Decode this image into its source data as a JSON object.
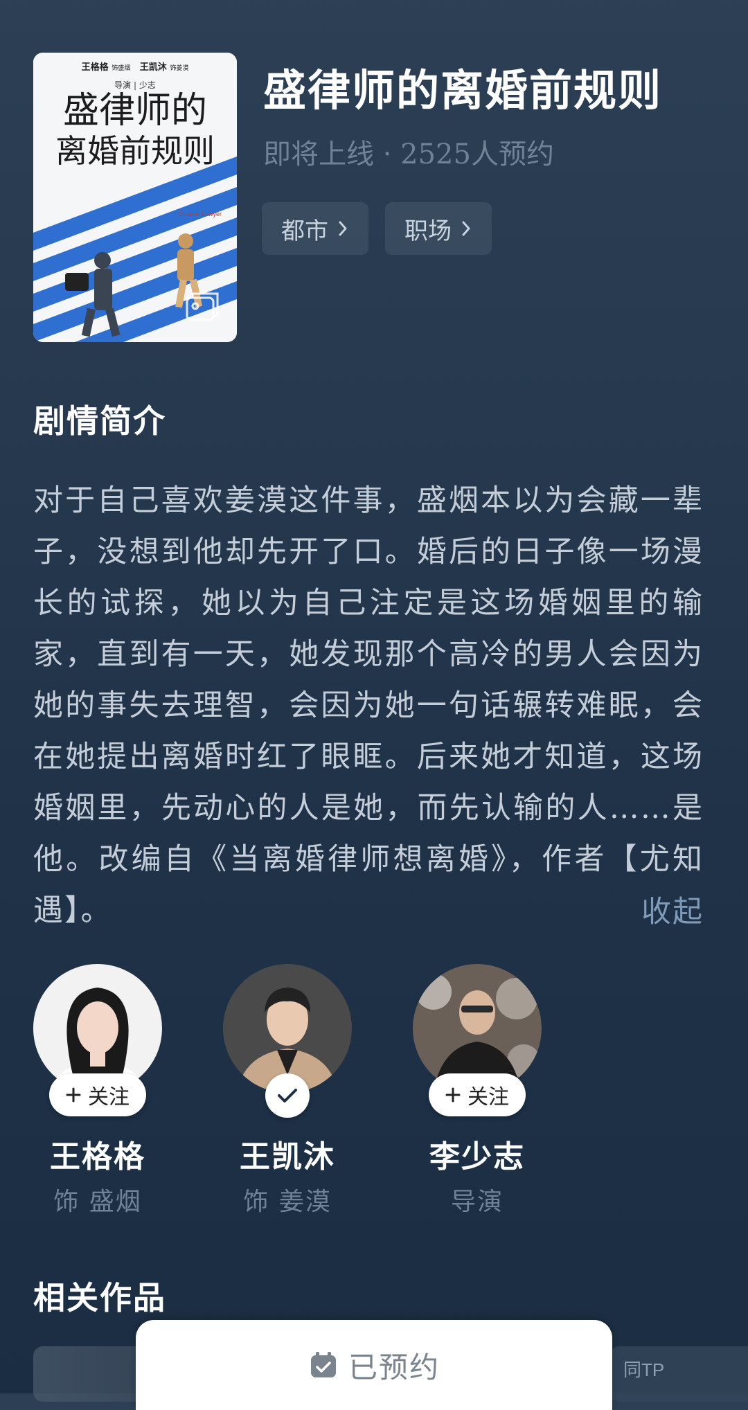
{
  "show": {
    "title": "盛律师的离婚前规则",
    "subtitle": "即将上线 · 2525人预约",
    "tags": [
      {
        "label": "都市"
      },
      {
        "label": "职场"
      }
    ]
  },
  "poster": {
    "cast_line_1": "王格格",
    "cast_line_1_role": "饰盛烟",
    "cast_line_2": "王凯沐",
    "cast_line_2_role": "饰姜漠",
    "director_line": "导演 | 少志",
    "title_line_1": "盛律师的",
    "title_line_2": "离婚前规则",
    "english_title": "Divorce Lawyer"
  },
  "synopsis": {
    "heading": "剧情简介",
    "text": "对于自己喜欢姜漠这件事，盛烟本以为会藏一辈子，没想到他却先开了口。婚后的日子像一场漫长的试探，她以为自己注定是这场婚姻里的输家，直到有一天，她发现那个高冷的男人会因为她的事失去理智，会因为她一句话辗转难眠，会在她提出离婚时红了眼眶。后来她才知道，这场婚姻里，先动心的人是她，而先认输的人……是他。改编自《当离婚律师想离婚》，作者【尤知遇】。",
    "collapse_label": "收起"
  },
  "cast": [
    {
      "name": "王格格",
      "role": "饰 盛烟",
      "follow_label": "关注",
      "followed": false
    },
    {
      "name": "王凯沐",
      "role": "饰 姜漠",
      "follow_label": "",
      "followed": true
    },
    {
      "name": "李少志",
      "role": "导演",
      "follow_label": "关注",
      "followed": false
    }
  ],
  "related": {
    "heading": "相关作品",
    "thumb_label": "同TP"
  },
  "bottom_bar": {
    "reserve_label": "已预约"
  },
  "colors": {
    "background_top": "#2c3f55",
    "background_bottom": "#1b2d42",
    "muted_text": "#6f8296",
    "link_blue": "#7f9bb8"
  }
}
